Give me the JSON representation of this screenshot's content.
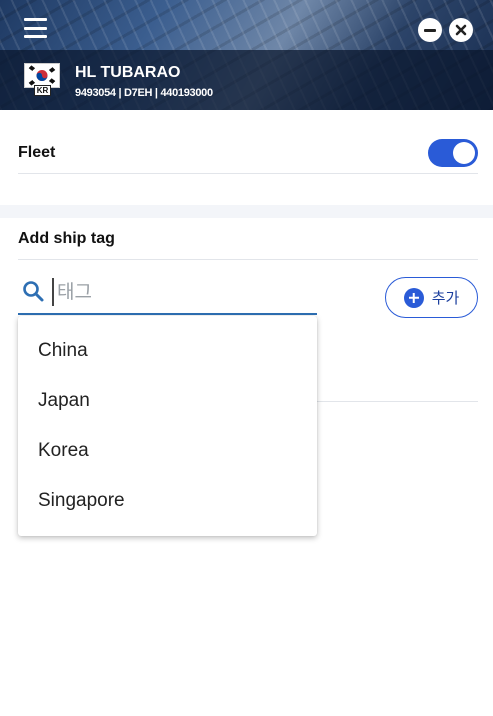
{
  "header": {
    "ship_name": "HL TUBARAO",
    "ship_ids": "9493054 | D7EH | 440193000",
    "flag_code": "KR"
  },
  "fleet": {
    "label": "Fleet",
    "enabled": true
  },
  "tags": {
    "title": "Add ship tag",
    "search_placeholder": "태그",
    "add_label": "추가",
    "options": [
      "China",
      "Japan",
      "Korea",
      "Singapore"
    ]
  },
  "colors": {
    "accent": "#2a5bd7",
    "input_underline": "#2e6fb3"
  }
}
